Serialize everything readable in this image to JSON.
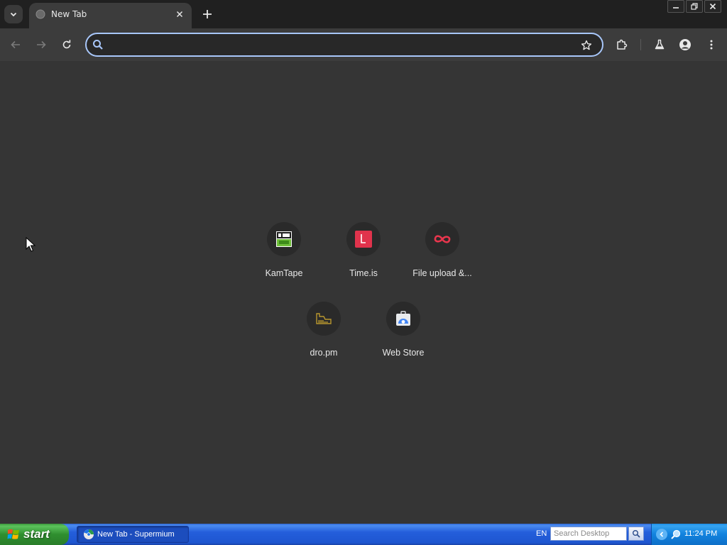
{
  "window": {
    "title": "New Tab - Supermium"
  },
  "tabs": [
    {
      "title": "New Tab",
      "active": true
    }
  ],
  "omnibox": {
    "value": "",
    "placeholder": ""
  },
  "shortcuts": [
    {
      "label": "KamTape",
      "icon": "kamtape-favicon"
    },
    {
      "label": "Time.is",
      "icon": "timeis-favicon"
    },
    {
      "label": "File upload &...",
      "icon": "fileupload-favicon"
    },
    {
      "label": "dro.pm",
      "icon": "dropm-favicon"
    },
    {
      "label": "Web Store",
      "icon": "webstore-favicon"
    }
  ],
  "taskbar": {
    "start_label": "start",
    "task_label": "New Tab - Supermium",
    "language": "EN",
    "search_placeholder": "Search Desktop",
    "clock": "11:24 PM"
  },
  "colors": {
    "tabstrip_bg": "#202020",
    "toolbar_bg": "#3c3c3c",
    "page_bg": "#353535",
    "omnibox_focus": "#a8c7fa",
    "timeis_red": "#e0334c",
    "fileupload_red": "#e8364d",
    "taskbar_blue": "#245edb",
    "start_green": "#3c9a3c"
  }
}
